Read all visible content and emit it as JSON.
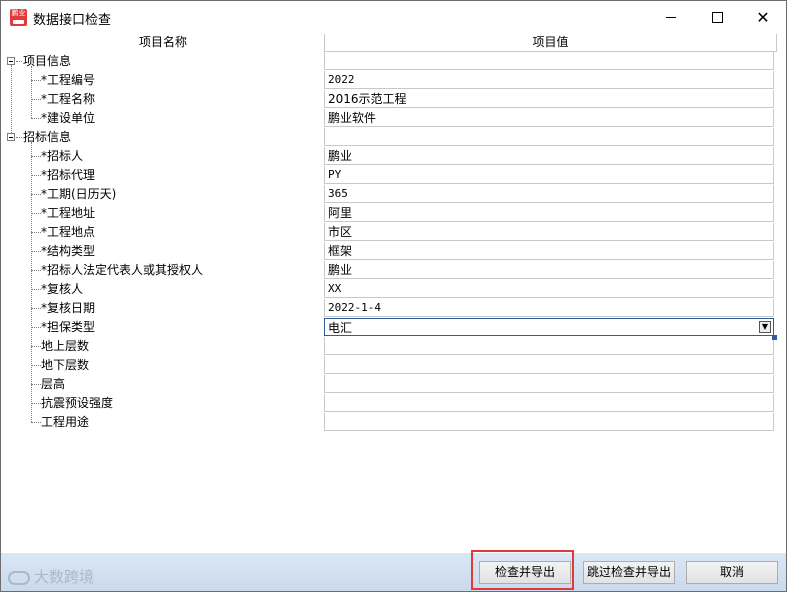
{
  "window": {
    "title": "数据接口检查",
    "app_icon_text": "鹏业"
  },
  "grid": {
    "col_name_header": "项目名称",
    "col_value_header": "项目值",
    "groups": [
      {
        "label": "项目信息",
        "items": [
          {
            "label": "*工程编号",
            "value": "2022"
          },
          {
            "label": "*工程名称",
            "value": "2016示范工程"
          },
          {
            "label": "*建设单位",
            "value": "鹏业软件"
          }
        ]
      },
      {
        "label": "招标信息",
        "items": [
          {
            "label": "*招标人",
            "value": "鹏业"
          },
          {
            "label": "*招标代理",
            "value": "PY"
          },
          {
            "label": "*工期(日历天)",
            "value": "365"
          },
          {
            "label": "*工程地址",
            "value": "阿里"
          },
          {
            "label": "*工程地点",
            "value": "市区"
          },
          {
            "label": "*结构类型",
            "value": "框架"
          },
          {
            "label": "*招标人法定代表人或其授权人",
            "value": "鹏业"
          },
          {
            "label": "*复核人",
            "value": "XX"
          },
          {
            "label": "*复核日期",
            "value": "2022-1-4"
          },
          {
            "label": "*担保类型",
            "value": "电汇"
          },
          {
            "label": "地上层数",
            "value": ""
          },
          {
            "label": "地下层数",
            "value": ""
          },
          {
            "label": "层高",
            "value": ""
          },
          {
            "label": "抗震预设强度",
            "value": ""
          },
          {
            "label": "工程用途",
            "value": ""
          }
        ]
      }
    ]
  },
  "footer": {
    "check_export": "检查并导出",
    "skip_check_export": "跳过检查并导出",
    "cancel": "取消"
  },
  "watermark": "大数跨境",
  "colors": {
    "highlight": "#e03a3a",
    "selection": "#2f5d9a",
    "footer_bg": "#cad9ec"
  }
}
